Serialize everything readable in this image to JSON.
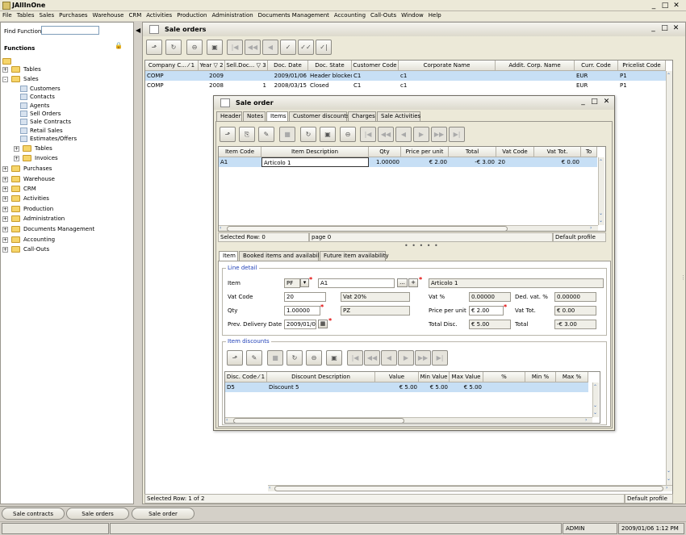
{
  "app": {
    "title": "JAllInOne",
    "min": "_",
    "max": "□",
    "close": "✕"
  },
  "menu": [
    "File",
    "Tables",
    "Sales",
    "Purchases",
    "Warehouse",
    "CRM",
    "Activities",
    "Production",
    "Administration",
    "Documents Management",
    "Accounting",
    "Call-Outs",
    "Window",
    "Help"
  ],
  "left": {
    "find_label": "Find Function",
    "find_value": "",
    "functions_title": "Functions",
    "tree": [
      {
        "label": "",
        "type": "folder",
        "level": 0,
        "exp": ""
      },
      {
        "label": "Tables",
        "type": "folder",
        "level": 0,
        "exp": "+"
      },
      {
        "label": "Sales",
        "type": "folder",
        "level": 0,
        "exp": "-"
      },
      {
        "label": "Customers",
        "type": "leaf",
        "level": 2,
        "exp": ""
      },
      {
        "label": "Contacts",
        "type": "leaf",
        "level": 2,
        "exp": ""
      },
      {
        "label": "Agents",
        "type": "leaf",
        "level": 2,
        "exp": ""
      },
      {
        "label": "Sell Orders",
        "type": "leaf",
        "level": 2,
        "exp": ""
      },
      {
        "label": "Sale Contracts",
        "type": "leaf",
        "level": 2,
        "exp": ""
      },
      {
        "label": "Retail Sales",
        "type": "leaf",
        "level": 2,
        "exp": ""
      },
      {
        "label": "Estimates/Offers",
        "type": "leaf",
        "level": 2,
        "exp": ""
      },
      {
        "label": "Tables",
        "type": "folder",
        "level": 1,
        "exp": "+"
      },
      {
        "label": "Invoices",
        "type": "folder",
        "level": 1,
        "exp": "+"
      },
      {
        "label": "Purchases",
        "type": "folder",
        "level": 0,
        "exp": "+"
      },
      {
        "label": "Warehouse",
        "type": "folder",
        "level": 0,
        "exp": "+"
      },
      {
        "label": "CRM",
        "type": "folder",
        "level": 0,
        "exp": "+"
      },
      {
        "label": "Activities",
        "type": "folder",
        "level": 0,
        "exp": "+"
      },
      {
        "label": "Production",
        "type": "folder",
        "level": 0,
        "exp": "+"
      },
      {
        "label": "Administration",
        "type": "folder",
        "level": 0,
        "exp": "+"
      },
      {
        "label": "Documents Management",
        "type": "folder",
        "level": 0,
        "exp": "+"
      },
      {
        "label": "Accounting",
        "type": "folder",
        "level": 0,
        "exp": "+"
      },
      {
        "label": "Call-Outs",
        "type": "folder",
        "level": 0,
        "exp": "+"
      }
    ]
  },
  "orders": {
    "title": "Sale orders",
    "columns": [
      "Company C... ⁄ 1",
      "Year ▽ 2",
      "Sell.Doc... ▽ 3",
      "Doc. Date",
      "Doc. State",
      "Customer Code",
      "Corporate Name",
      "Addit. Corp. Name",
      "Curr. Code",
      "Pricelist Code"
    ],
    "rows": [
      [
        "COMP",
        "2009",
        "",
        "2009/01/06",
        "Header blocked",
        "C1",
        "c1",
        "",
        "EUR",
        "P1"
      ],
      [
        "COMP",
        "2008",
        "1",
        "2008/03/15",
        "Closed",
        "C1",
        "c1",
        "",
        "EUR",
        "P1"
      ]
    ],
    "status_left": "Selected Row: 1 of 2",
    "status_right": "Default profile"
  },
  "dialog": {
    "title": "Sale order",
    "tabs": [
      "Header",
      "Notes",
      "Items",
      "Customer discounts",
      "Charges",
      "Sale Activities"
    ],
    "items_columns": [
      "Item Code",
      "Item Description",
      "Qty",
      "Price per unit",
      "Total",
      "Vat Code",
      "Vat Tot.",
      "To"
    ],
    "items_rows": [
      [
        "A1",
        "Articolo 1",
        "1.00000",
        "€ 2.00",
        "-€ 3.00",
        "20",
        "€ 0.00",
        ""
      ]
    ],
    "items_status": {
      "left": "Selected Row: 0",
      "mid": "page 0",
      "right": "Default profile"
    },
    "sep": "• • • • •",
    "subtabs": [
      "Item",
      "Booked items and availability",
      "Future item availability"
    ],
    "line_detail": {
      "legend": "Line detail",
      "item_label": "Item",
      "item_type": "PF",
      "item_code": "A1",
      "item_desc": "Articolo 1",
      "dots": "...",
      "plus": "+",
      "vat_code_label": "Vat Code",
      "vat_code": "20",
      "vat_desc": "Vat 20%",
      "vat_perc_label": "Vat %",
      "vat_perc": "0.00000",
      "ded_vat_label": "Ded. vat. %",
      "ded_vat": "0.00000",
      "qty_label": "Qty",
      "qty": "1.00000",
      "um": "PZ",
      "price_label": "Price per unit",
      "price": "€ 2.00",
      "vat_tot_label": "Vat Tot.",
      "vat_tot": "€ 0.00",
      "delivery_label": "Prev. Delivery Date",
      "delivery": "2009/01/06",
      "disc_label": "Total Disc.",
      "disc": "€ 5.00",
      "total_label": "Total",
      "total": "-€ 3.00"
    },
    "discounts": {
      "legend": "Item discounts",
      "columns": [
        "Disc. Code ⁄ 1",
        "Discount Description",
        "Value",
        "Min Value",
        "Max Value",
        "%",
        "Min %",
        "Max %"
      ],
      "rows": [
        [
          "D5",
          "Discount 5",
          "€ 5.00",
          "€ 5.00",
          "€ 5.00",
          "",
          "",
          ""
        ]
      ]
    }
  },
  "taskbar": [
    "Sale contracts",
    "Sale orders",
    "Sale order"
  ],
  "bottom": {
    "user": "ADMIN",
    "datetime": "2009/01/06 1:12 PM"
  }
}
